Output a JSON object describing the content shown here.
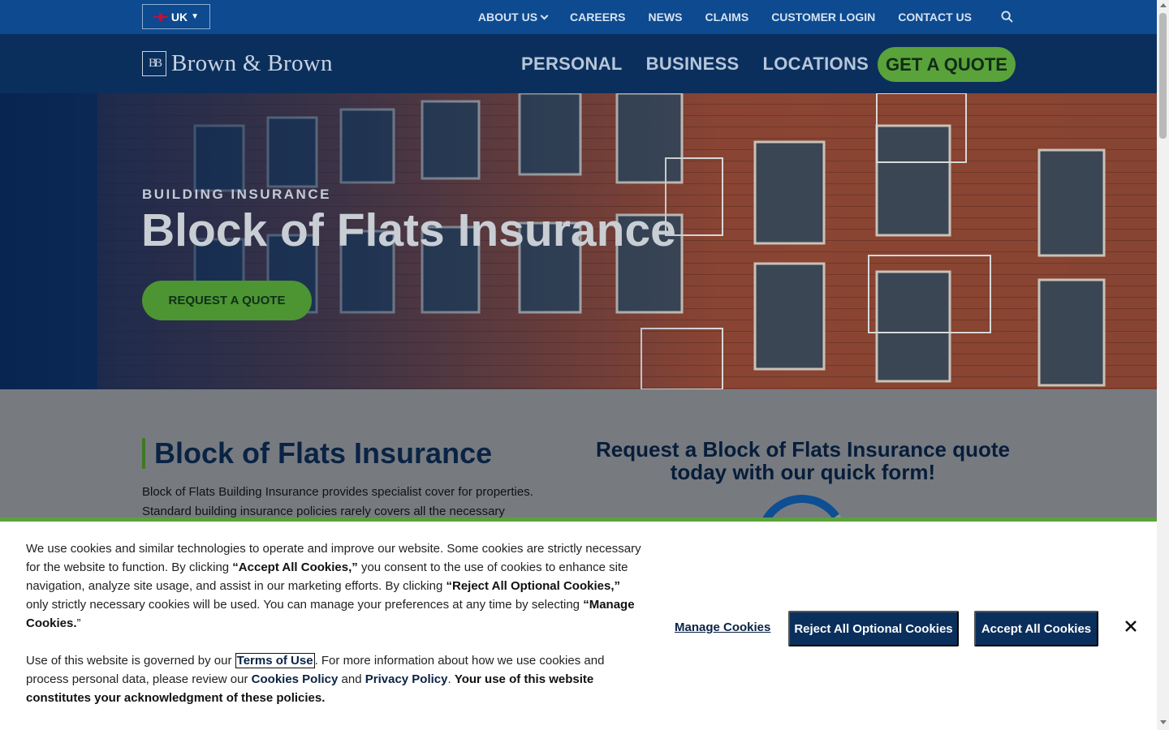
{
  "utility_bar": {
    "region_label": "UK",
    "nav": [
      "ABOUT US",
      "CAREERS",
      "NEWS",
      "CLAIMS",
      "CUSTOMER LOGIN",
      "CONTACT US"
    ]
  },
  "header": {
    "logo_mark": "BB",
    "logo_text": "Brown & Brown",
    "nav": [
      "PERSONAL",
      "BUSINESS",
      "LOCATIONS"
    ],
    "quote_button": "GET A QUOTE"
  },
  "hero": {
    "eyebrow": "BUILDING INSURANCE",
    "title": "Block of Flats Insurance",
    "button": "REQUEST A QUOTE"
  },
  "content": {
    "title": "Block of Flats Insurance",
    "body": "Block of Flats Building Insurance provides specialist cover for properties. Standard building insurance policies rarely covers all the necessary",
    "form_heading": "Request a Block of Flats Insurance quote today with our quick form!"
  },
  "cookie_banner": {
    "p1_a": "We use cookies and similar technologies to operate and improve our website. Some cookies are strictly necessary for the website to function. By clicking ",
    "p1_b": "“Accept All Cookies,”",
    "p1_c": " you consent to the use of cookies to enhance site navigation, analyze site usage, and assist in our marketing efforts. By clicking ",
    "p1_d": "“Reject All Optional Cookies,”",
    "p1_e": " only strictly necessary cookies will be used. You can manage your preferences at any time by selecting ",
    "p1_f": "“Manage Cookies.",
    "p1_g": "”",
    "p2_a": "Use of this website is governed by our ",
    "terms_link": "Terms of Use",
    "p2_b": ". For more information about how we use cookies and process personal data, please review our ",
    "cookies_policy_link": "Cookies Policy",
    "p2_c": " and ",
    "privacy_policy_link": "Privacy Policy",
    "p2_d": ". ",
    "p2_e": "Your use of this website constitutes your acknowledgment of these policies.",
    "manage_label": "Manage Cookies",
    "reject_label": "Reject All Optional Cookies",
    "accept_label": "Accept All Cookies"
  },
  "colors": {
    "utility_bg": "#0d4a8f",
    "header_bg": "#0b2f5c",
    "accent_green": "#5aa23a",
    "navy_text": "#0a2344"
  },
  "icons": [
    "flag-icon",
    "chevron-down-icon",
    "search-icon",
    "close-icon"
  ]
}
